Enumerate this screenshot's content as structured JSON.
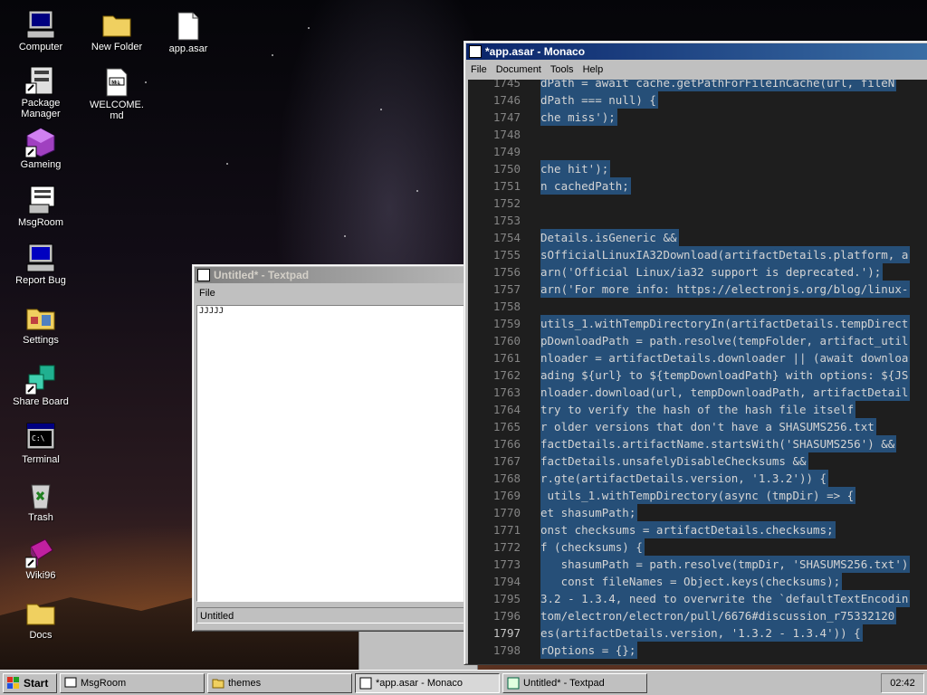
{
  "desktop_icons": [
    {
      "label": "Computer"
    },
    {
      "label": "Package Manager"
    },
    {
      "label": "Gameing"
    },
    {
      "label": "MsgRoom"
    },
    {
      "label": "Report Bug"
    },
    {
      "label": "Settings"
    },
    {
      "label": "Share Board"
    },
    {
      "label": "Terminal"
    },
    {
      "label": "Trash"
    },
    {
      "label": "Wiki96"
    },
    {
      "label": "Docs"
    },
    {
      "label": "New Folder"
    },
    {
      "label": "WELCOME.md"
    },
    {
      "label": "app.asar"
    }
  ],
  "monaco": {
    "title": "*app.asar - Monaco",
    "menu": [
      "File",
      "Document",
      "Tools",
      "Help"
    ],
    "lines": [
      {
        "n": "1745",
        "code": "dPath = await cache.getPathForFileInCache(url, fileN"
      },
      {
        "n": "1746",
        "code": "dPath === null) {"
      },
      {
        "n": "1747",
        "code": "che miss');"
      },
      {
        "n": "1748",
        "code": ""
      },
      {
        "n": "1749",
        "code": ""
      },
      {
        "n": "1750",
        "code": "che hit');"
      },
      {
        "n": "1751",
        "code": "n cachedPath;"
      },
      {
        "n": "1752",
        "code": ""
      },
      {
        "n": "1753",
        "code": ""
      },
      {
        "n": "1754",
        "code": "Details.isGeneric &&"
      },
      {
        "n": "1755",
        "code": "sOfficialLinuxIA32Download(artifactDetails.platform, a"
      },
      {
        "n": "1756",
        "code": "arn('Official Linux/ia32 support is deprecated.');"
      },
      {
        "n": "1757",
        "code": "arn('For more info: https://electronjs.org/blog/linux-"
      },
      {
        "n": "1758",
        "code": ""
      },
      {
        "n": "1759",
        "code": "utils_1.withTempDirectoryIn(artifactDetails.tempDirect"
      },
      {
        "n": "1760",
        "code": "pDownloadPath = path.resolve(tempFolder, artifact_util"
      },
      {
        "n": "1761",
        "code": "nloader = artifactDetails.downloader || (await downloa"
      },
      {
        "n": "1762",
        "code": "ading ${url} to ${tempDownloadPath} with options: ${JS"
      },
      {
        "n": "1763",
        "code": "nloader.download(url, tempDownloadPath, artifactDetail"
      },
      {
        "n": "1764",
        "code": "try to verify the hash of the hash file itself"
      },
      {
        "n": "1765",
        "code": "r older versions that don't have a SHASUMS256.txt"
      },
      {
        "n": "1766",
        "code": "factDetails.artifactName.startsWith('SHASUMS256') &&"
      },
      {
        "n": "1767",
        "code": "factDetails.unsafelyDisableChecksums &&"
      },
      {
        "n": "1768",
        "code": "r.gte(artifactDetails.version, '1.3.2')) {"
      },
      {
        "n": "1769",
        "code": " utils_1.withTempDirectory(async (tmpDir) => {"
      },
      {
        "n": "1770",
        "code": "et shasumPath;"
      },
      {
        "n": "1771",
        "code": "onst checksums = artifactDetails.checksums;"
      },
      {
        "n": "1772",
        "code": "f (checksums) {"
      },
      {
        "n": "1773",
        "code": "   shasumPath = path.resolve(tmpDir, 'SHASUMS256.txt')"
      },
      {
        "n": "1794",
        "code": "   const fileNames = Object.keys(checksums);"
      },
      {
        "n": "1795",
        "code": "3.2 - 1.3.4, need to overwrite the `defaultTextEncodin"
      },
      {
        "n": "1796",
        "code": "tom/electron/electron/pull/6676#discussion_r75332120"
      },
      {
        "n": "1797",
        "code": "es(artifactDetails.version, '1.3.2 - 1.3.4')) {"
      },
      {
        "n": "1798",
        "code": "rOptions = {};"
      }
    ]
  },
  "textpad": {
    "title": "Untitled* - Textpad",
    "menu": [
      "File"
    ],
    "content": "JJJJJ",
    "status": "Untitled"
  },
  "taskbar": {
    "start": "Start",
    "buttons": [
      {
        "label": "MsgRoom"
      },
      {
        "label": "themes"
      },
      {
        "label": "*app.asar - Monaco"
      },
      {
        "label": "Untitled* - Textpad"
      }
    ],
    "clock": "02:42"
  },
  "colors": {
    "selection": "#264f78",
    "title_active": "#0a246a",
    "editor_bg": "#1e1e1e"
  }
}
